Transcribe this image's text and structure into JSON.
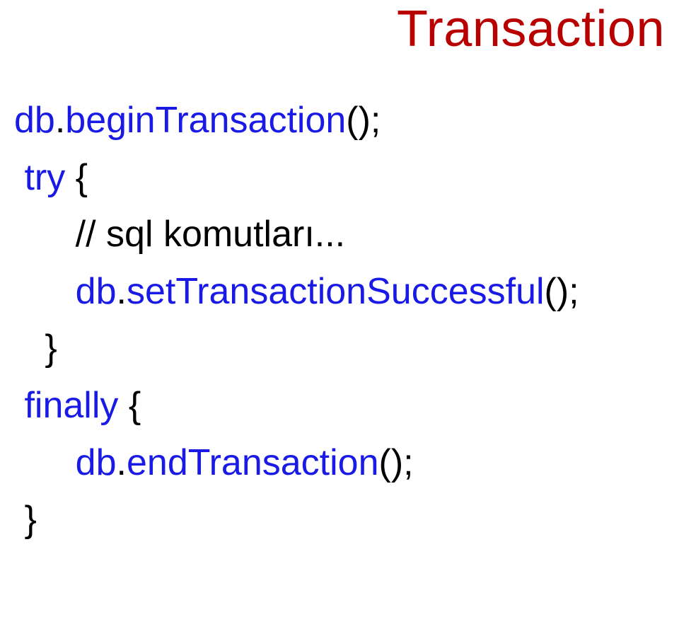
{
  "title": "Transaction",
  "code": {
    "l1a": "db",
    "l1b": ".",
    "l1c": "beginTransaction",
    "l1d": "();",
    "l2a": " try",
    "l2b": " {",
    "l3": "      // sql komutları...",
    "l4a": "      db",
    "l4b": ".",
    "l4c": "setTransactionSuccessful",
    "l4d": "();",
    "l5": "   }",
    "l6a": " finally",
    "l6b": " {",
    "l7a": "      db",
    "l7b": ".",
    "l7c": "endTransaction",
    "l7d": "();",
    "l8": " }"
  }
}
